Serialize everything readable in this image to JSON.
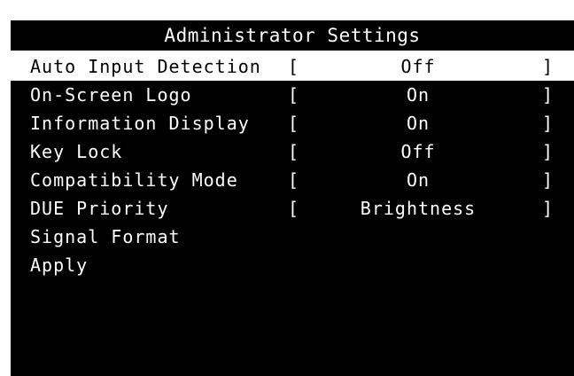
{
  "title": "Administrator Settings",
  "items": [
    {
      "label": "Auto Input Detection",
      "value": "Off",
      "selected": true
    },
    {
      "label": "On-Screen Logo",
      "value": "On"
    },
    {
      "label": "Information Display",
      "value": "On"
    },
    {
      "label": "Key Lock",
      "value": "Off"
    },
    {
      "label": "Compatibility Mode",
      "value": "On"
    },
    {
      "label": "DUE Priority",
      "value": "Brightness"
    },
    {
      "label": "Signal Format"
    },
    {
      "label": "Apply"
    }
  ],
  "brackets": {
    "left": "[",
    "right": "]"
  },
  "colors": {
    "background": "#000000",
    "text": "#ffffff",
    "highlight": "#ffffff"
  }
}
